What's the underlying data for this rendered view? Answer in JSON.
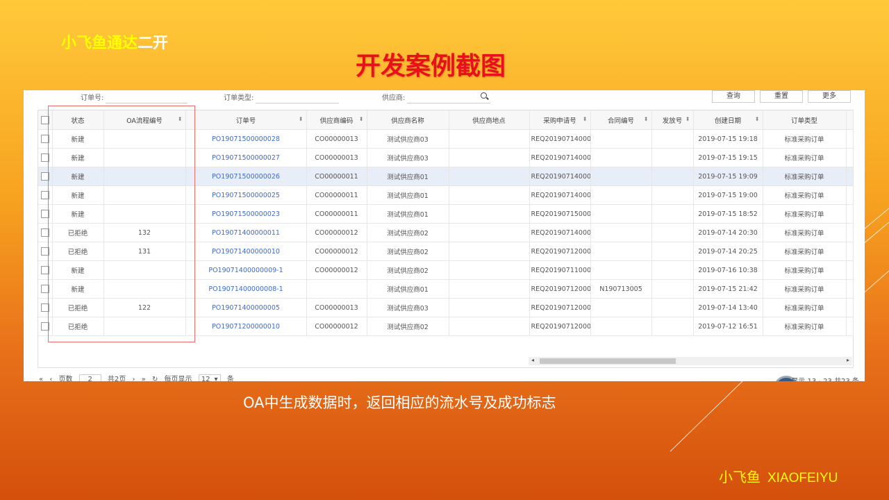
{
  "slide": {
    "brand_yellow": "小飞鱼通达",
    "brand_white": "二开",
    "title": "开发案例截图",
    "caption": "OA中生成数据时，返回相应的流水号及成功标志",
    "footer_cn": "小飞鱼",
    "footer_en": "XIAOFEIYU"
  },
  "filter": {
    "order_no_label": "订单号:",
    "order_type_label": "订单类型:",
    "supplier_label": "供应商:",
    "query_button": "查询",
    "reset_button": "重置",
    "more_button": "更多"
  },
  "columns": [
    "状态",
    "OA流程编号",
    "订单号",
    "供应商编码",
    "供应商名称",
    "供应商地点",
    "采购申请号",
    "合同编号",
    "发放号",
    "创建日期",
    "订单类型"
  ],
  "rows": [
    {
      "status": "新建",
      "oa": "",
      "order": "PO19071500000028",
      "sup_code": "CO00000013",
      "sup_name": "测试供应商03",
      "sup_loc": "",
      "req": "REQ20190714000...",
      "contract": "",
      "release": "",
      "date": "2019-07-15 19:18",
      "type": "标准采购订单"
    },
    {
      "status": "新建",
      "oa": "",
      "order": "PO19071500000027",
      "sup_code": "CO00000013",
      "sup_name": "测试供应商03",
      "sup_loc": "",
      "req": "REQ20190714000...",
      "contract": "",
      "release": "",
      "date": "2019-07-15 19:15",
      "type": "标准采购订单"
    },
    {
      "status": "新建",
      "oa": "",
      "order": "PO19071500000026",
      "sup_code": "CO00000011",
      "sup_name": "测试供应商01",
      "sup_loc": "",
      "req": "REQ20190714000...",
      "contract": "",
      "release": "",
      "date": "2019-07-15 19:09",
      "type": "标准采购订单"
    },
    {
      "status": "新建",
      "oa": "",
      "order": "PO19071500000025",
      "sup_code": "CO00000011",
      "sup_name": "测试供应商01",
      "sup_loc": "",
      "req": "REQ20190714000...",
      "contract": "",
      "release": "",
      "date": "2019-07-15 19:00",
      "type": "标准采购订单"
    },
    {
      "status": "新建",
      "oa": "",
      "order": "PO19071500000023",
      "sup_code": "CO00000011",
      "sup_name": "测试供应商01",
      "sup_loc": "",
      "req": "REQ20190715000...",
      "contract": "",
      "release": "",
      "date": "2019-07-15 18:52",
      "type": "标准采购订单"
    },
    {
      "status": "已拒绝",
      "oa": "132",
      "order": "PO19071400000011",
      "sup_code": "CO00000012",
      "sup_name": "测试供应商02",
      "sup_loc": "",
      "req": "REQ20190714000...",
      "contract": "",
      "release": "",
      "date": "2019-07-14 20:30",
      "type": "标准采购订单"
    },
    {
      "status": "已拒绝",
      "oa": "131",
      "order": "PO19071400000010",
      "sup_code": "CO00000012",
      "sup_name": "测试供应商02",
      "sup_loc": "",
      "req": "REQ20190712000...",
      "contract": "",
      "release": "",
      "date": "2019-07-14 20:25",
      "type": "标准采购订单"
    },
    {
      "status": "新建",
      "oa": "",
      "order": "PO19071400000009-1",
      "sup_code": "CO00000012",
      "sup_name": "测试供应商02",
      "sup_loc": "",
      "req": "REQ20190711000...",
      "contract": "",
      "release": "",
      "date": "2019-07-16 10:38",
      "type": "标准采购订单"
    },
    {
      "status": "新建",
      "oa": "",
      "order": "PO19071400000008-1",
      "sup_code": "",
      "sup_name": "测试供应商01",
      "sup_loc": "",
      "req": "REQ20190712000...",
      "contract": "N190713005",
      "release": "",
      "date": "2019-07-15 21:42",
      "type": "标准采购订单"
    },
    {
      "status": "已拒绝",
      "oa": "122",
      "order": "PO19071400000005",
      "sup_code": "CO00000013",
      "sup_name": "测试供应商03",
      "sup_loc": "",
      "req": "REQ20190712000...",
      "contract": "",
      "release": "",
      "date": "2019-07-14 13:40",
      "type": "标准采购订单"
    },
    {
      "status": "已拒绝",
      "oa": "",
      "order": "PO19071200000010",
      "sup_code": "CO00000012",
      "sup_name": "测试供应商02",
      "sup_loc": "",
      "req": "REQ20190712000...",
      "contract": "",
      "release": "",
      "date": "2019-07-12 16:51",
      "type": "标准采购订单"
    }
  ],
  "highlighted_row": 2,
  "pager": {
    "pages_label": "页数",
    "current_page": "2",
    "total_pages": "共2页",
    "page_size_label": "每页显示",
    "page_size": "12",
    "unit": "条",
    "range_text": "显示 13 - 23 共23 条"
  }
}
